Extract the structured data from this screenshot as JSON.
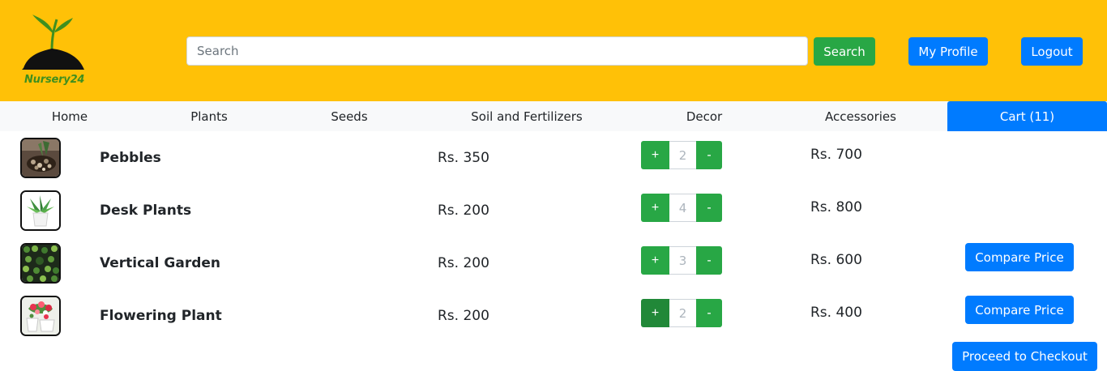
{
  "brand": {
    "name": "Nursery24",
    "logo_icon": "sprout-on-soil-icon"
  },
  "search": {
    "placeholder": "Search",
    "button_label": "Search"
  },
  "header_buttons": {
    "profile_label": "My Profile",
    "logout_label": "Logout"
  },
  "nav": {
    "items": [
      "Home",
      "Plants",
      "Seeds",
      "Soil and Fertilizers",
      "Decor",
      "Accessories"
    ],
    "cart_label": "Cart (11)"
  },
  "cart": {
    "items": [
      {
        "name": "Pebbles",
        "price": "Rs. 350",
        "quantity": "2",
        "total": "Rs. 700",
        "image_icon": "pebbles-pot-image"
      },
      {
        "name": "Desk Plants",
        "price": "Rs. 200",
        "quantity": "4",
        "total": "Rs. 800",
        "image_icon": "desk-plant-image"
      },
      {
        "name": "Vertical Garden",
        "price": "Rs. 200",
        "quantity": "3",
        "total": "Rs. 600",
        "image_icon": "vertical-garden-image",
        "compare_label": "Compare Price"
      },
      {
        "name": "Flowering Plant",
        "price": "Rs. 200",
        "quantity": "2",
        "total": "Rs. 400",
        "image_icon": "flowering-plant-image",
        "compare_label": "Compare Price"
      }
    ],
    "qty_plus": "+",
    "qty_minus": "-",
    "checkout_label": "Proceed to Checkout"
  },
  "colors": {
    "header": "#ffc107",
    "primary": "#007bff",
    "success": "#28a745",
    "nav_bg": "#f8f9fa"
  }
}
